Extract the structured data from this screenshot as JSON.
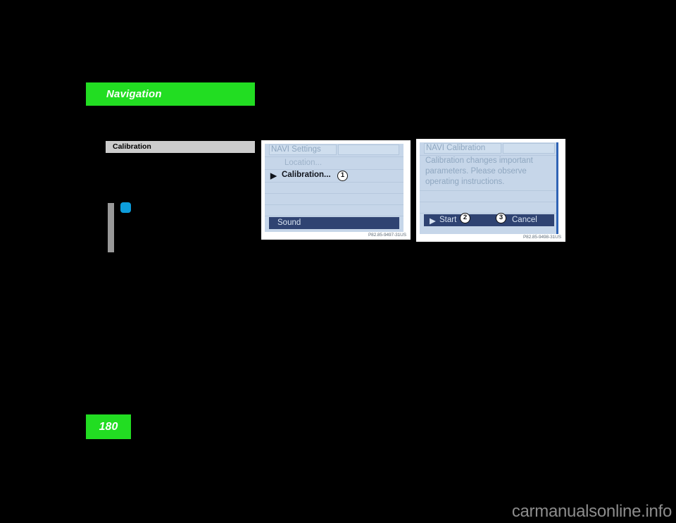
{
  "page": {
    "section_title": "Navigation",
    "subject_title": "Calibration",
    "page_number": "180",
    "watermark": "carmanualsonline.info",
    "colors": {
      "background": "#000000",
      "accent_green": "#22dd22",
      "subject_bar": "#cccccc",
      "bullet_dot": "#0d9ddb",
      "screen_bg": "#c6d6e9",
      "screen_highlight": "#2f4372",
      "screen_text_dim": "#8fa7c0",
      "scrollbar": "#2f63b5",
      "watermark": "#8c8c8c"
    }
  },
  "figures": [
    {
      "id": "navi-settings",
      "title": "NAVI Settings",
      "items": [
        {
          "label": "Location...",
          "state": "dim",
          "marker": ""
        },
        {
          "label": "Calibration...",
          "state": "active",
          "marker": "▶",
          "callout": "1"
        }
      ],
      "highlight_bar": {
        "label": "Sound"
      },
      "caption_id": "P82.85-9497-31US"
    },
    {
      "id": "navi-calibration",
      "title": "NAVI Calibration",
      "body_lines": [
        "Calibration changes important",
        "parameters. Please observe",
        "operating instructions."
      ],
      "actions": [
        {
          "label": "Start",
          "marker": "▶",
          "callout": "2",
          "callout_side": "after"
        },
        {
          "label": "Cancel",
          "marker": "",
          "callout": "3",
          "callout_side": "before"
        }
      ],
      "caption_id": "P82.85-9498-31US"
    }
  ]
}
